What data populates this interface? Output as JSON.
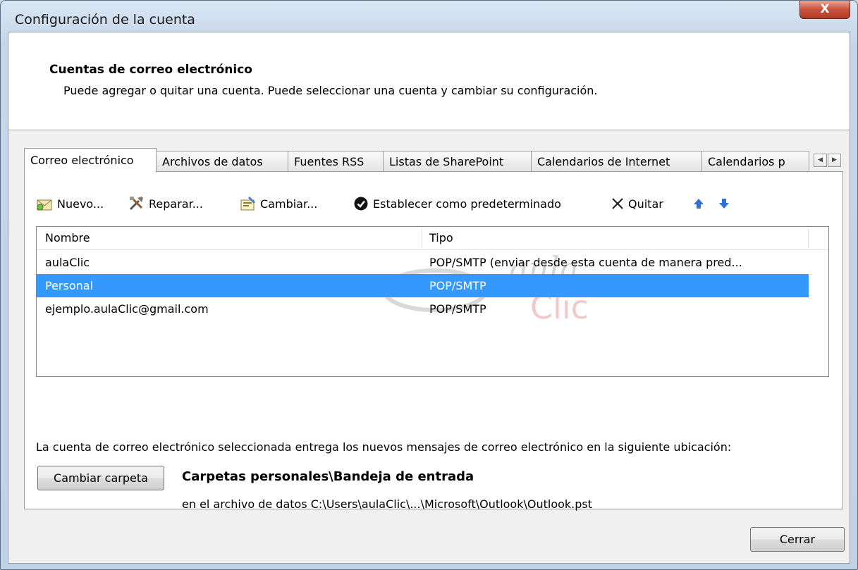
{
  "window": {
    "title": "Configuración de la cuenta",
    "close_glyph": "X"
  },
  "header": {
    "title": "Cuentas de correo electrónico",
    "description": "Puede agregar o quitar una cuenta. Puede seleccionar una cuenta y cambiar su configuración."
  },
  "tabs": [
    {
      "label": "Correo electrónico",
      "active": true
    },
    {
      "label": "Archivos de datos"
    },
    {
      "label": "Fuentes RSS"
    },
    {
      "label": "Listas de SharePoint"
    },
    {
      "label": "Calendarios de Internet"
    },
    {
      "label": "Calendarios p"
    }
  ],
  "tab_scroll": {
    "left": "◀",
    "right": "▶"
  },
  "toolbar": {
    "new_label": "Nuevo...",
    "repair_label": "Reparar...",
    "change_label": "Cambiar...",
    "default_label": "Establecer como predeterminado",
    "remove_label": "Quitar"
  },
  "accounts": {
    "columns": {
      "name": "Nombre",
      "type": "Tipo"
    },
    "rows": [
      {
        "name": "aulaClic",
        "type": "POP/SMTP (enviar desde esta cuenta de manera pred..."
      },
      {
        "name": "Personal",
        "type": "POP/SMTP",
        "selected": true
      },
      {
        "name": "ejemplo.aulaClic@gmail.com",
        "type": "POP/SMTP"
      }
    ]
  },
  "watermark": {
    "line1": "aula",
    "line2": "Clic"
  },
  "delivery": {
    "info": "La cuenta de correo electrónico seleccionada entrega los nuevos mensajes de correo electrónico en la siguiente ubicación:",
    "change_folder_label": "Cambiar carpeta",
    "folder": "Carpetas personales\\Bandeja de entrada",
    "path": "en el archivo de datos C:\\Users\\aulaClic\\...\\Microsoft\\Outlook\\Outlook.pst"
  },
  "footer": {
    "close_label": "Cerrar"
  },
  "colors": {
    "selection": "#3399ff",
    "close_button": "#c9533d",
    "arrow": "#2f6fd6"
  }
}
